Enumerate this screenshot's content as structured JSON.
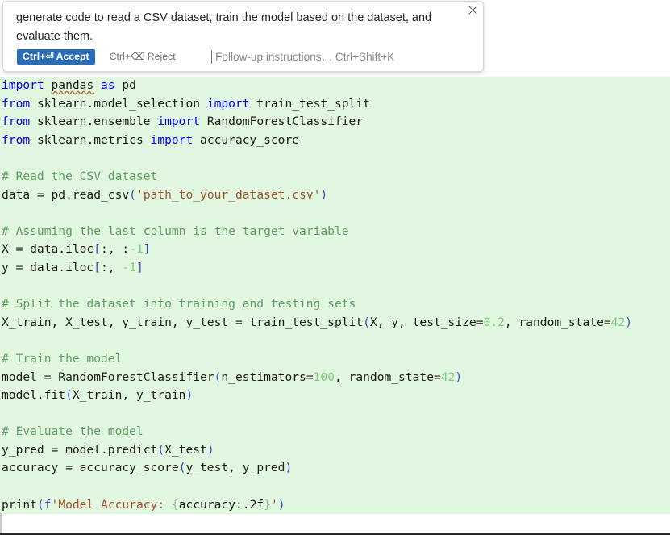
{
  "popup": {
    "prompt_text": "generate code to read a CSV dataset, train the model based on the dataset, and evaluate them.",
    "close_icon": "close-icon",
    "accept_label": "Ctrl+⏎ Accept",
    "reject_label": "Ctrl+⌫ Reject",
    "followup_placeholder": "Follow-up instructions… Ctrl+Shift+K",
    "accent_color": "#2a6cb5"
  },
  "editor": {
    "diff_added_background": "#e2f7e0",
    "language": "python",
    "colors": {
      "keyword": "#0000ff",
      "comment": "#5f9e63",
      "string": "#a0522d",
      "number": "#7fc97f",
      "punctuation": "#3b4cc0",
      "text": "#1a1a1a"
    },
    "lines": [
      [
        {
          "t": "import",
          "c": "kw"
        },
        {
          "t": " ",
          "c": "plain"
        },
        {
          "t": "pandas",
          "c": "plain",
          "squiggle": true
        },
        {
          "t": " ",
          "c": "plain"
        },
        {
          "t": "as",
          "c": "kw"
        },
        {
          "t": " pd",
          "c": "plain"
        }
      ],
      [
        {
          "t": "from",
          "c": "kw"
        },
        {
          "t": " sklearn.model_selection ",
          "c": "plain"
        },
        {
          "t": "import",
          "c": "kw"
        },
        {
          "t": " train_test_split",
          "c": "plain"
        }
      ],
      [
        {
          "t": "from",
          "c": "kw"
        },
        {
          "t": " sklearn.ensemble ",
          "c": "plain"
        },
        {
          "t": "import",
          "c": "kw"
        },
        {
          "t": " RandomForestClassifier",
          "c": "plain"
        }
      ],
      [
        {
          "t": "from",
          "c": "kw"
        },
        {
          "t": " sklearn.metrics ",
          "c": "plain"
        },
        {
          "t": "import",
          "c": "kw"
        },
        {
          "t": " accuracy_score",
          "c": "plain"
        }
      ],
      [],
      [
        {
          "t": "# Read the CSV dataset",
          "c": "cmt"
        }
      ],
      [
        {
          "t": "data = pd.read_csv",
          "c": "plain"
        },
        {
          "t": "(",
          "c": "punc"
        },
        {
          "t": "'path_to_your_dataset.csv'",
          "c": "str"
        },
        {
          "t": ")",
          "c": "punc"
        }
      ],
      [],
      [
        {
          "t": "# Assuming the last column is the target variable",
          "c": "cmt"
        }
      ],
      [
        {
          "t": "X = data.iloc",
          "c": "plain"
        },
        {
          "t": "[",
          "c": "punc"
        },
        {
          "t": ":, :",
          "c": "plain"
        },
        {
          "t": "-1",
          "c": "num"
        },
        {
          "t": "]",
          "c": "punc"
        }
      ],
      [
        {
          "t": "y = data.iloc",
          "c": "plain"
        },
        {
          "t": "[",
          "c": "punc"
        },
        {
          "t": ":, ",
          "c": "plain"
        },
        {
          "t": "-1",
          "c": "num"
        },
        {
          "t": "]",
          "c": "punc"
        }
      ],
      [],
      [
        {
          "t": "# Split the dataset into training and testing sets",
          "c": "cmt"
        }
      ],
      [
        {
          "t": "X_train, X_test, y_train, y_test = train_test_split",
          "c": "plain"
        },
        {
          "t": "(",
          "c": "punc"
        },
        {
          "t": "X, y, test_size=",
          "c": "plain"
        },
        {
          "t": "0.2",
          "c": "num"
        },
        {
          "t": ", random_state=",
          "c": "plain"
        },
        {
          "t": "42",
          "c": "num"
        },
        {
          "t": ")",
          "c": "punc"
        }
      ],
      [],
      [
        {
          "t": "# Train the model",
          "c": "cmt"
        }
      ],
      [
        {
          "t": "model = RandomForestClassifier",
          "c": "plain"
        },
        {
          "t": "(",
          "c": "punc"
        },
        {
          "t": "n_estimators=",
          "c": "plain"
        },
        {
          "t": "100",
          "c": "num"
        },
        {
          "t": ", random_state=",
          "c": "plain"
        },
        {
          "t": "42",
          "c": "num"
        },
        {
          "t": ")",
          "c": "punc"
        }
      ],
      [
        {
          "t": "model.fit",
          "c": "plain"
        },
        {
          "t": "(",
          "c": "punc"
        },
        {
          "t": "X_train, y_train",
          "c": "plain"
        },
        {
          "t": ")",
          "c": "punc"
        }
      ],
      [],
      [
        {
          "t": "# Evaluate the model",
          "c": "cmt"
        }
      ],
      [
        {
          "t": "y_pred = model.predict",
          "c": "plain"
        },
        {
          "t": "(",
          "c": "punc"
        },
        {
          "t": "X_test",
          "c": "plain"
        },
        {
          "t": ")",
          "c": "punc"
        }
      ],
      [
        {
          "t": "accuracy = accuracy_score",
          "c": "plain"
        },
        {
          "t": "(",
          "c": "punc"
        },
        {
          "t": "y_test, y_pred",
          "c": "plain"
        },
        {
          "t": ")",
          "c": "punc"
        }
      ],
      [],
      [
        {
          "t": "print",
          "c": "plain"
        },
        {
          "t": "(",
          "c": "punc"
        },
        {
          "t": "f",
          "c": "punc"
        },
        {
          "t": "'Model Accuracy: ",
          "c": "str"
        },
        {
          "t": "{",
          "c": "brace"
        },
        {
          "t": "accuracy:.2f",
          "c": "plain"
        },
        {
          "t": "}",
          "c": "brace"
        },
        {
          "t": "'",
          "c": "str"
        },
        {
          "t": ")",
          "c": "punc"
        }
      ]
    ]
  }
}
